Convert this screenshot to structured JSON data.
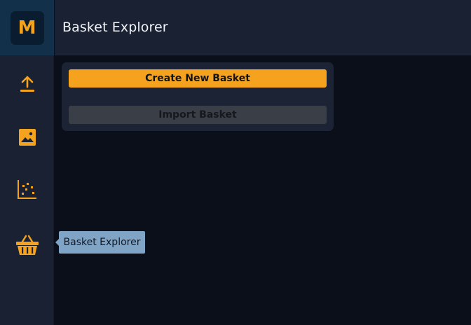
{
  "app": {
    "logo_letter": "M",
    "accent_color": "#f5a31f"
  },
  "header": {
    "title": "Basket Explorer"
  },
  "sidebar": {
    "items": [
      {
        "icon": "upload-icon"
      },
      {
        "icon": "image-icon"
      },
      {
        "icon": "scatter-plot-icon"
      },
      {
        "icon": "basket-icon",
        "tooltip": "Basket Explorer"
      }
    ]
  },
  "main": {
    "create_label": "Create New Basket",
    "import_label": "Import Basket"
  }
}
